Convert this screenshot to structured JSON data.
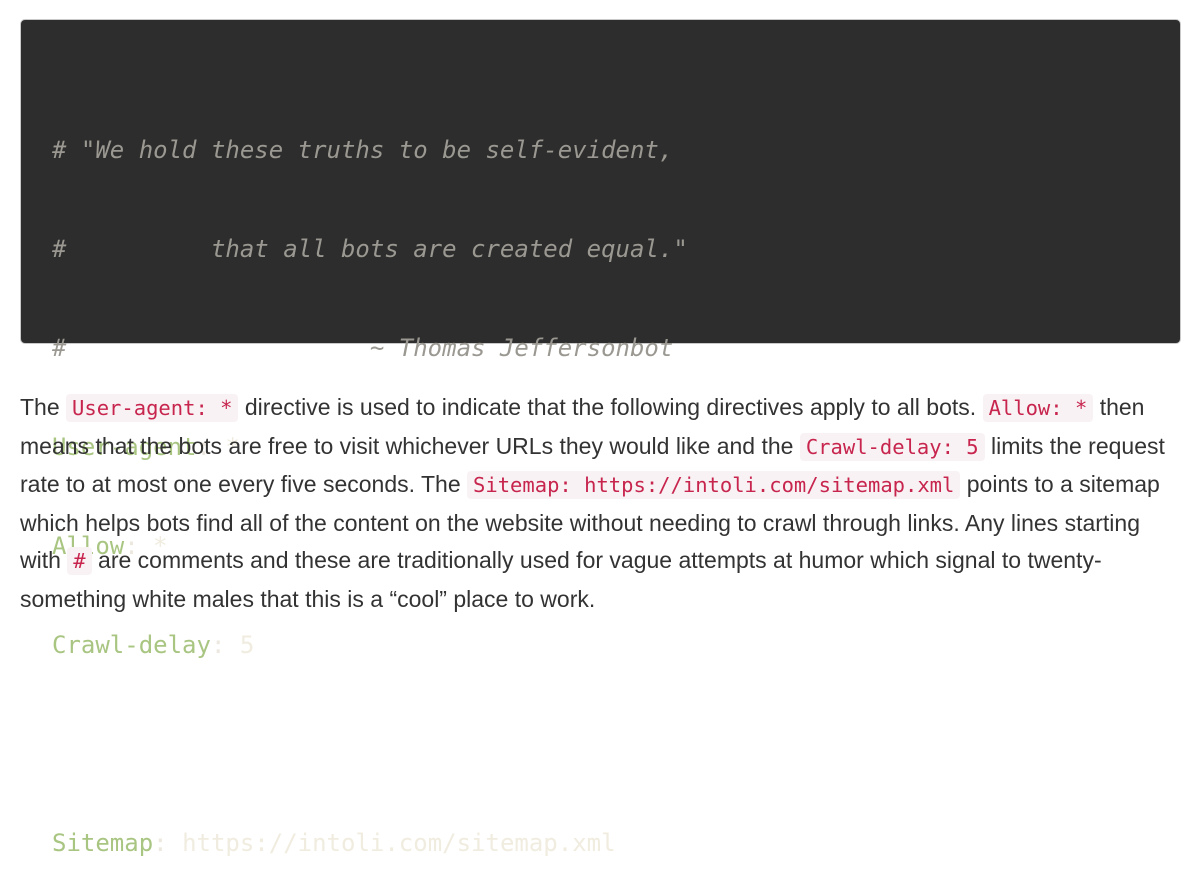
{
  "code": {
    "lines": [
      {
        "comment": "# \"We hold these truths to be self-evident,"
      },
      {
        "comment": "#          that all bots are created equal.\""
      },
      {
        "comment": "#                     ~ Thomas Jeffersonbot"
      },
      {
        "key": "User-agent",
        "value": "*"
      },
      {
        "key": "Allow",
        "value": "*"
      },
      {
        "key": "Crawl-delay",
        "value": "5"
      },
      {
        "blank": ""
      },
      {
        "key": "Sitemap",
        "value": "https://intoli.com/sitemap.xml"
      }
    ]
  },
  "paragraph": {
    "t1": "The ",
    "c1": "User-agent: *",
    "t2": " directive is used to indicate that the following directives apply to all bots. ",
    "c2": "Allow: *",
    "t3": " then means that the bots are free to visit whichever URLs they would like and the ",
    "c3": "Crawl-delay: 5",
    "t4": " limits the request rate to at most one every five seconds. The ",
    "c4": "Sitemap: https://intoli.com/sitemap.xml",
    "t5": " points to a sitemap which helps bots find all of the content on the website without needing to crawl through links. Any lines starting with ",
    "c5": "#",
    "t6": " are comments and these are traditionally used for vague attempts at humor which signal to twenty-something white males that this is a “cool” place to work."
  }
}
